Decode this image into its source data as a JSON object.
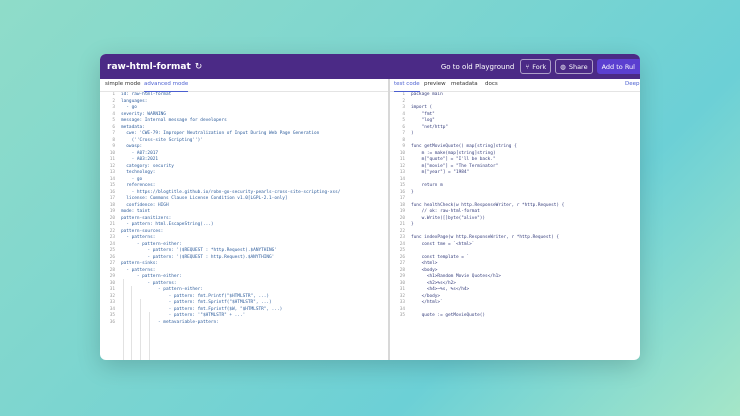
{
  "app": {
    "title": "raw-html-format",
    "refresh_icon": "refresh-icon",
    "old_playground": "Go to old Playground",
    "fork": "Fork",
    "share": "Share",
    "add_rule": "Add to Rul",
    "accent": "#4b2a86"
  },
  "left_tabs": [
    "simple mode",
    "advanced mode"
  ],
  "right_tabs": [
    "test code",
    "preview",
    "metadata",
    "docs"
  ],
  "right_tab_partial": "Deep",
  "rule_lines": [
    "id: raw-html-format",
    "languages:",
    "  - go",
    "severity: WARNING",
    "message: Internal message for developers",
    "metadata:",
    "  cwe: 'CWE-79: Improper Neutralization of Input During Web Page Generation",
    "    (''Cross-site Scripting'')'",
    "  owasp:",
    "    - A07:2017",
    "    - A03:2021",
    "  category: security",
    "  technology:",
    "    - go",
    "  references:",
    "    - https://blogtitle.github.io/robn-go-security-pearls-cross-site-scripting-xss/",
    "  license: Commons Clause License Condition v1.0[LGPL-2.1-only]",
    "  confidence: HIGH",
    "mode: taint",
    "pattern-sanitizers:",
    "  - pattern: html.EscapeString(...)",
    "pattern-sources:",
    "  - patterns:",
    "      - pattern-either:",
    "          - pattern: '($REQUEST : *http.Request).$ANYTHING'",
    "          - pattern: '($REQUEST : http.Request).$ANYTHING'",
    "pattern-sinks:",
    "  - patterns:",
    "      - pattern-either:",
    "          - patterns:",
    "              - pattern-either:",
    "                  - pattern: fmt.Printf(\"$HTMLSTR\", ...)",
    "                  - pattern: fmt.Sprintf(\"$HTMLSTR\", ...)",
    "                  - pattern: fmt.Fprintf($W, \"$HTMLSTR\", ...)",
    "                  - pattern: '\"$HTMLSTR\" + ...'",
    "              - metavariable-pattern:"
  ],
  "test_lines": [
    "package main",
    "",
    "import (",
    "    \"fmt\"",
    "    \"log\"",
    "    \"net/http\"",
    ")",
    "",
    "func getMovieQuote() map[string]string {",
    "    m := make(map[string]string)",
    "    m[\"quote\"] = \"I'll be back.\"",
    "    m[\"movie\"] = \"The Terminator\"",
    "    m[\"year\"] = \"1984\"",
    "",
    "    return m",
    "}",
    "",
    "func healthCheck(w http.ResponseWriter, r *http.Request) {",
    "    // ok: raw-html-format",
    "    w.Write([]byte(\"alive\"))",
    "}",
    "",
    "func indexPage(w http.ResponseWriter, r *http.Request) {",
    "    const tme = `<html>`",
    "",
    "    const template = `",
    "    <html>",
    "    <body>",
    "      <h1>Random Movie Quotes</h1>",
    "      <h2>%s</h2>",
    "      <h4>~%s, %s</h4>",
    "    </body>",
    "    </html>`",
    "",
    "    quote := getMovieQuote()"
  ]
}
